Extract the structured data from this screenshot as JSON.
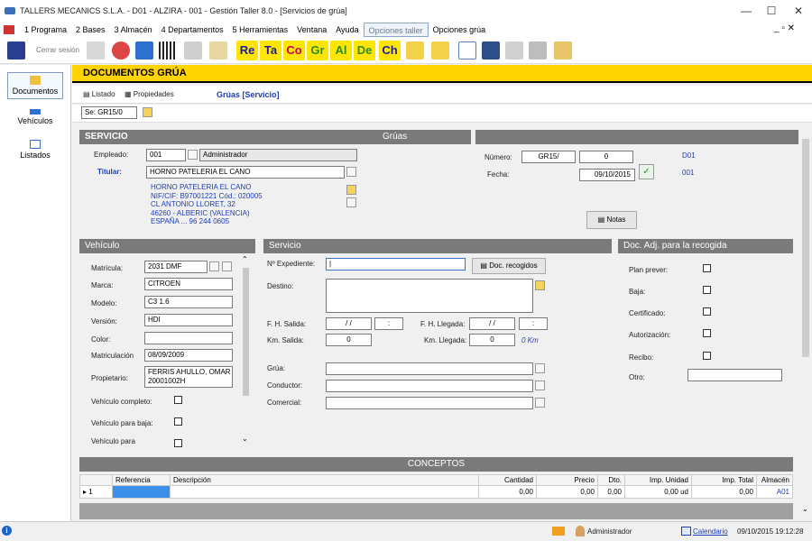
{
  "window": {
    "title": "TALLERS MECANICS S.L.A. - D01 - ALZIRA - 001 - Gestión Taller 8.0 - [Servicios de grúa]",
    "minimize": "—",
    "maximize": "☐",
    "close": "✕"
  },
  "menu": {
    "items": [
      "1 Programa",
      "2 Bases",
      "3 Almacén",
      "4 Departamentos",
      "5 Herramientas",
      "Ventana",
      "Ayuda",
      "Opciones taller",
      "Opciones grúa"
    ],
    "restore": "_ ▫ ✕"
  },
  "toolbar": {
    "logout": "Cerrar sesión",
    "words": [
      "Re",
      "Ta",
      "Co",
      "Gr",
      "Al",
      "De",
      "Ch"
    ],
    "word_colors": [
      "#1a1aa8",
      "#1a1aa8",
      "#c4006a",
      "#2e8b2e",
      "#2e8b2e",
      "#2e8b2e",
      "#1a1aa8"
    ],
    "word_bgs": [
      "#ffe600",
      "#ffe600",
      "#ffe600",
      "#ffe600",
      "#ffe600",
      "#ffe600",
      "#ffe600"
    ]
  },
  "nav": {
    "documentos": "Documentos",
    "vehiculos": "Vehículos",
    "listados": "Listados"
  },
  "header": {
    "title": "DOCUMENTOS GRÚA"
  },
  "subbar": {
    "listado": "Listado",
    "propiedades": "Propiedades",
    "title": "Grúas [Servicio]",
    "serie": "Se: GR15/0"
  },
  "servicio": {
    "header": "SERVICIO",
    "center": "Grúas",
    "empleado_label": "Empleado:",
    "empleado_code": "001",
    "empleado_name": "Administrador",
    "titular_label": "Titular:",
    "titular_value": "HORNO PATELERIA EL CANO",
    "address": [
      "HORNO PATELERIA EL CANO",
      "NIF/CIF: B97001221  Cód.: 020005",
      "CL ANTONIO LLORET, 32",
      "46260 - ALBERIC (VALENCIA)",
      "ESPAÑA ... 96 244 0605"
    ],
    "numero_label": "Número:",
    "numero_serie": "GR15/",
    "numero_value": "0",
    "numero_code": "D01",
    "fecha_label": "Fecha:",
    "fecha_value": "09/10/2015",
    "fecha_code": "001",
    "notas": "Notas"
  },
  "vehiculo": {
    "header": "Vehículo",
    "matricula_label": "Matrícula:",
    "matricula": "2031 DMF",
    "marca_label": "Marca:",
    "marca": "CITROEN",
    "modelo_label": "Modelo:",
    "modelo": "C3 1.6",
    "version_label": "Versión:",
    "version": "HDI",
    "color_label": "Color:",
    "color": "",
    "matriculacion_label": "Matriculación",
    "matriculacion": "08/09/2009",
    "propietario_label": "Propietario:",
    "propietario": [
      "FERRIS AHULLO, OMAR",
      "20001002H"
    ],
    "completo_label": "Vehículo completo:",
    "baja_label": "Vehículo para baja:",
    "para_label": "Vehículo para"
  },
  "servicio2": {
    "header": "Servicio",
    "expediente_label": "Nº Expediente:",
    "doc_button": "Doc. recogidos",
    "destino_label": "Destino:",
    "fh_salida_label": "F. H.  Salida:",
    "fh_salida_date": " /  /",
    "fh_salida_time": ":",
    "fh_llegada_label": "F. H. Llegada:",
    "fh_llegada_date": " /  /",
    "fh_llegada_time": ":",
    "km_salida_label": "Km. Salida:",
    "km_salida": "0",
    "km_llegada_label": "Km. Llegada:",
    "km_llegada": "0",
    "km_total": "0 Km",
    "grua_label": "Grúa:",
    "conductor_label": "Conductor:",
    "comercial_label": "Comercial:"
  },
  "docadj": {
    "header": "Doc. Adj. para la recogida",
    "items": [
      "Plan prever:",
      "Baja:",
      "Certificado:",
      "Autorización:",
      "Recibo:"
    ],
    "otro_label": "Otro:"
  },
  "conceptos": {
    "header": "CONCEPTOS",
    "columns": [
      "",
      "Referencia",
      "Descripción",
      "Cantidad",
      "Precio",
      "Dto.",
      "Imp. Unidad",
      "Imp. Total",
      "Almacén"
    ],
    "row": [
      "▸  1",
      "",
      "",
      "0,00",
      "0,00",
      "0,00",
      "0,00 ud",
      "0,00",
      "A01"
    ]
  },
  "status": {
    "user": "Administrador",
    "calendar": "Calendario",
    "datetime": "09/10/2015 19:12:28"
  }
}
